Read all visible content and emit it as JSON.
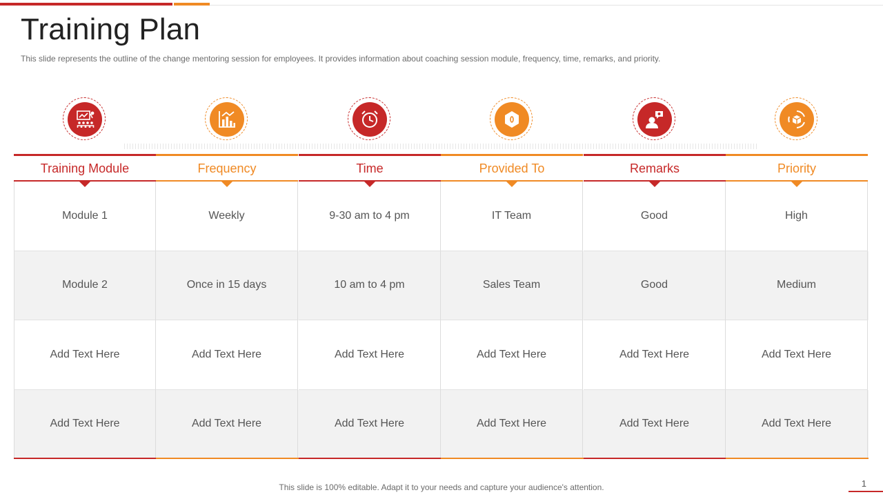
{
  "slide": {
    "title": "Training Plan",
    "subtitle": "This slide represents the outline of the change mentoring session for employees. It provides  information  about coaching session module, frequency,  time, remarks, and priority.",
    "footer": "This slide is 100% editable. Adapt it to your needs and capture your audience's attention.",
    "page_number": "1"
  },
  "colors": {
    "red": "#c62828",
    "orange": "#f08a24"
  },
  "columns": [
    {
      "label": "Training Module",
      "icon": "presentation-board-icon",
      "color": "red"
    },
    {
      "label": "Frequency",
      "icon": "bar-chart-icon",
      "color": "orange"
    },
    {
      "label": "Time",
      "icon": "alarm-clock-icon",
      "color": "red"
    },
    {
      "label": "Provided To",
      "icon": "hexagon-badge-icon",
      "color": "orange"
    },
    {
      "label": "Remarks",
      "icon": "user-feedback-icon",
      "color": "red"
    },
    {
      "label": "Priority",
      "icon": "target-cycle-icon",
      "color": "orange"
    }
  ],
  "rows": [
    [
      "Module 1",
      "Weekly",
      "9-30 am to 4 pm",
      "IT Team",
      "Good",
      "High"
    ],
    [
      "Module 2",
      "Once in 15 days",
      "10 am to 4 pm",
      "Sales Team",
      "Good",
      "Medium"
    ],
    [
      "Add Text Here",
      "Add Text Here",
      "Add Text Here",
      "Add Text Here",
      "Add Text Here",
      "Add Text Here"
    ],
    [
      "Add Text Here",
      "Add Text Here",
      "Add Text Here",
      "Add Text Here",
      "Add Text Here",
      "Add Text Here"
    ]
  ]
}
